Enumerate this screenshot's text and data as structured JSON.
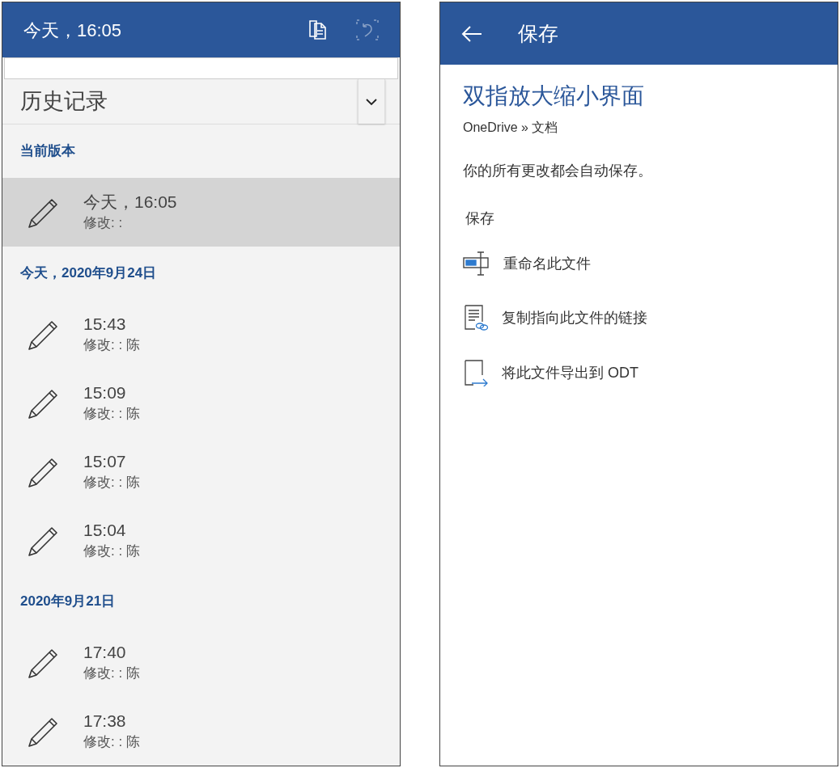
{
  "history_panel": {
    "title": "今天，16:05",
    "toolbar_buttons": [
      {
        "kind": "copy",
        "disabled": false
      },
      {
        "kind": "undo",
        "disabled": true
      }
    ],
    "dropdown": {
      "label": "历史记录"
    },
    "sections": [
      {
        "heading": "当前版本",
        "versions": [
          {
            "time": "今天，16:05",
            "modified_by": "修改: :",
            "selected": true
          }
        ]
      },
      {
        "heading": "今天，2020年9月24日",
        "versions": [
          {
            "time": "15:43",
            "modified_by": "修改: : 陈",
            "selected": false
          },
          {
            "time": "15:09",
            "modified_by": "修改: : 陈",
            "selected": false
          },
          {
            "time": "15:07",
            "modified_by": "修改: : 陈",
            "selected": false
          },
          {
            "time": "15:04",
            "modified_by": "修改: : 陈",
            "selected": false
          }
        ]
      },
      {
        "heading": "2020年9月21日",
        "versions": [
          {
            "time": "17:40",
            "modified_by": "修改: : 陈",
            "selected": false
          },
          {
            "time": "17:38",
            "modified_by": "修改: : 陈",
            "selected": false
          }
        ]
      }
    ]
  },
  "save_panel": {
    "title": "保存",
    "document_title": "双指放大缩小界面",
    "location": "OneDrive » 文档",
    "note": "你的所有更改都会自动保存。",
    "section_label": "保存",
    "actions": [
      {
        "kind": "rename",
        "label": "重命名此文件"
      },
      {
        "kind": "copy_link",
        "label": "复制指向此文件的链接"
      },
      {
        "kind": "export",
        "label": "将此文件导出到 ODT"
      }
    ]
  }
}
